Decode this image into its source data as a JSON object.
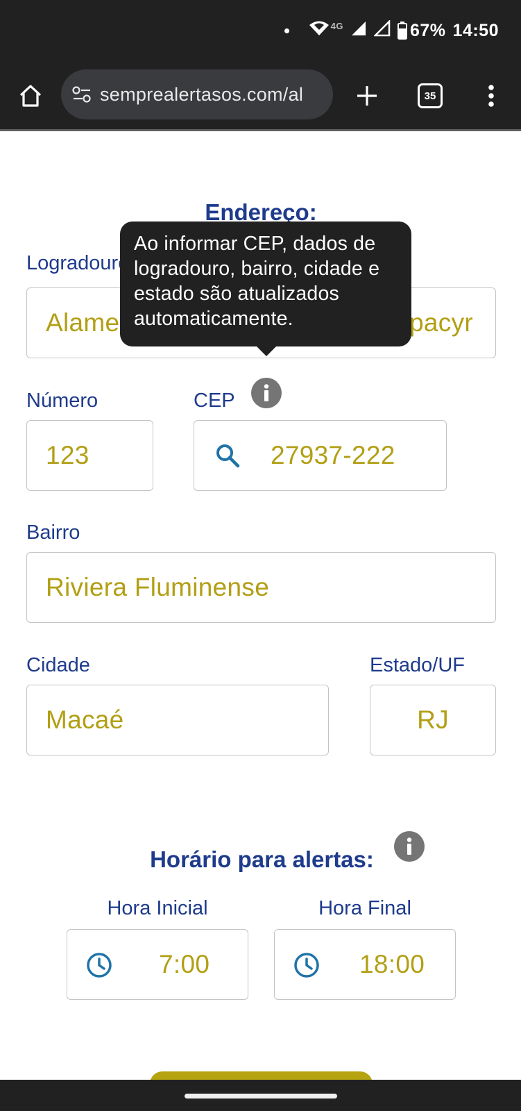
{
  "status_bar": {
    "network": "4G",
    "battery": "67%",
    "time": "14:50"
  },
  "browser": {
    "url": "semprealertasos.com/al",
    "tab_count": "35"
  },
  "address_section": {
    "title": "Endereço:",
    "logradouro": {
      "label": "Logradouro",
      "value_start": "Alame",
      "value_end": "pacyr"
    },
    "numero": {
      "label": "Número",
      "value": "123"
    },
    "cep": {
      "label": "CEP",
      "value": "27937-222"
    },
    "bairro": {
      "label": "Bairro",
      "value": "Riviera Fluminense"
    },
    "cidade": {
      "label": "Cidade",
      "value": "Macaé"
    },
    "estado": {
      "label": "Estado/UF",
      "value": "RJ"
    },
    "tooltip": "Ao informar CEP, dados de logradouro, bairro, cidade e estado são atualizados automaticamente."
  },
  "alerts_section": {
    "title": "Horário para alertas:",
    "hora_inicial": {
      "label": "Hora Inicial",
      "value": "7:00"
    },
    "hora_final": {
      "label": "Hora Final",
      "value": "18:00"
    }
  },
  "colors": {
    "label": "#1e3b8c",
    "value": "#b29f14",
    "icon_blue": "#1f73a8",
    "chrome_dark": "#212121"
  },
  "icons": [
    "home-icon",
    "site-settings-icon",
    "new-tab-icon",
    "tab-switcher-icon",
    "more-menu-icon",
    "search-icon",
    "clock-icon",
    "info-icon"
  ]
}
